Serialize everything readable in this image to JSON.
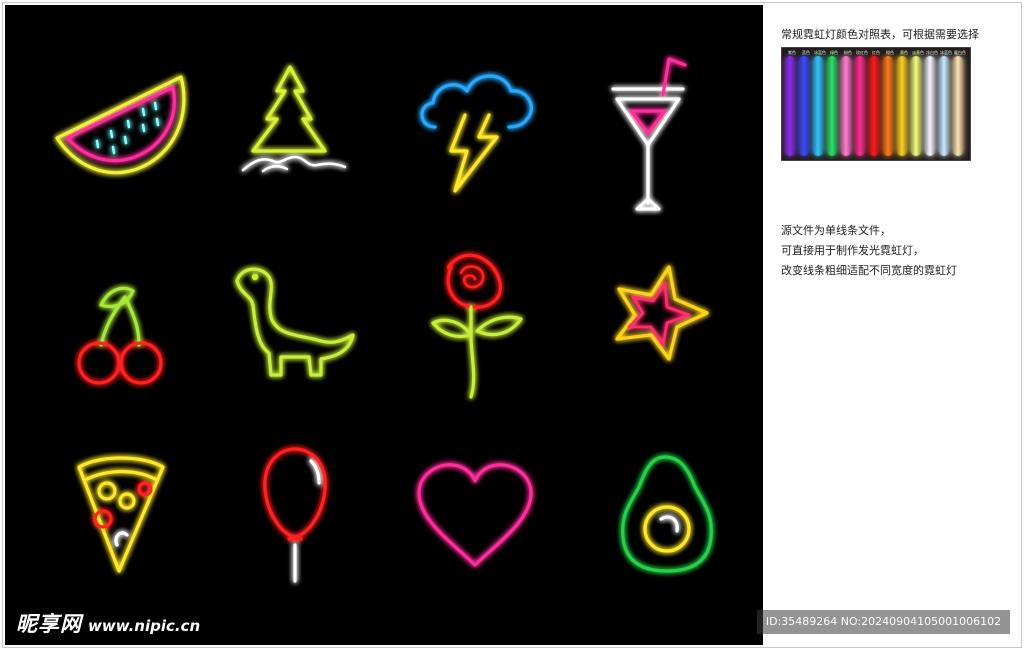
{
  "side_panel": {
    "palette_title": "常规霓虹灯颜色对照表，可根据需要选择",
    "palette_labels": [
      "紫色",
      "蓝色",
      "冰蓝色",
      "绿色",
      "粉色",
      "玫红色",
      "红色",
      "橙色",
      "黄色",
      "淡黄色",
      "冷白色",
      "冰蓝色",
      "暖白色"
    ],
    "palette_colors": [
      "#8b2cf0",
      "#3a4cff",
      "#31c4ff",
      "#27e36a",
      "#ff7fd0",
      "#ff2d8f",
      "#ff1a1a",
      "#ff7a1a",
      "#ffd21f",
      "#f4ff7a",
      "#f5f5ff",
      "#c9eaff",
      "#ffe2b0"
    ],
    "notes": [
      "源文件为单线条文件，",
      "可直接用于制作发光霓虹灯，",
      "改变线条粗细适配不同宽度的霓虹灯"
    ]
  },
  "watermark": {
    "logo_cn": "昵享网",
    "logo_url": "www.nipic.cn",
    "id_text": "ID:35489264 NO:20240904105001006102"
  },
  "icons": [
    {
      "name": "watermelon",
      "colors": [
        "#f1f23a",
        "#ff2d9a",
        "#7fffff"
      ]
    },
    {
      "name": "pine-tree",
      "colors": [
        "#d8f23a",
        "#ffffff"
      ]
    },
    {
      "name": "cloud-lightning",
      "colors": [
        "#2aa8ff",
        "#ffe82a"
      ]
    },
    {
      "name": "cocktail",
      "colors": [
        "#ffffff",
        "#ff2d9a"
      ]
    },
    {
      "name": "cherries",
      "colors": [
        "#a6e83a",
        "#ff2020"
      ]
    },
    {
      "name": "dinosaur",
      "colors": [
        "#c8f03a"
      ]
    },
    {
      "name": "rose",
      "colors": [
        "#ff2020",
        "#c8f03a"
      ]
    },
    {
      "name": "star",
      "colors": [
        "#ffd21f",
        "#ff2d6a"
      ]
    },
    {
      "name": "pizza-slice",
      "colors": [
        "#ffe82a",
        "#ff2020",
        "#ffffff"
      ]
    },
    {
      "name": "balloon",
      "colors": [
        "#ff2020",
        "#ffffff"
      ]
    },
    {
      "name": "heart",
      "colors": [
        "#ff2d9a"
      ]
    },
    {
      "name": "avocado",
      "colors": [
        "#27d04a",
        "#ffe82a",
        "#ffffff"
      ]
    }
  ]
}
